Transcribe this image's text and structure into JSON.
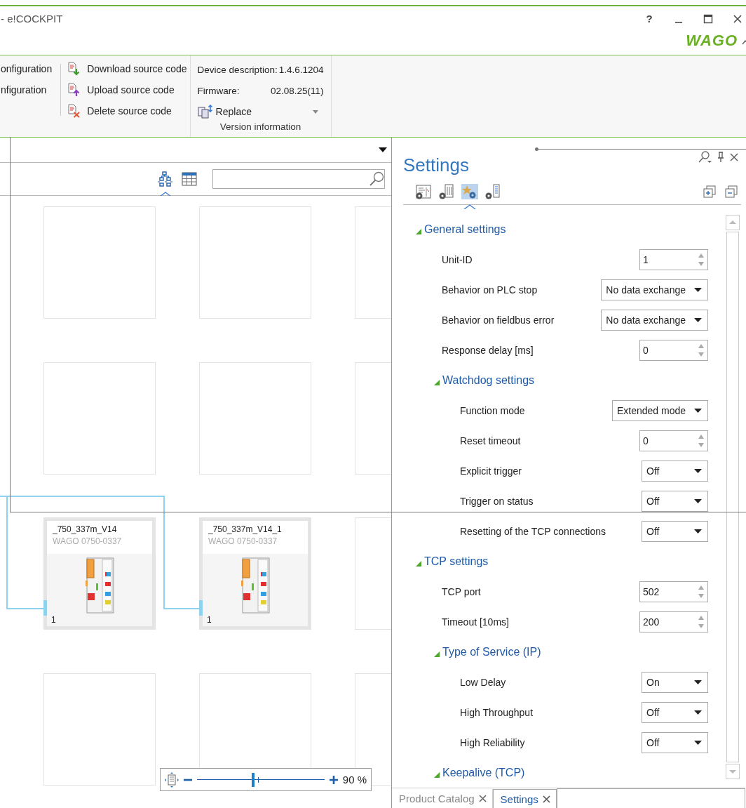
{
  "window": {
    "title": "- e!COCKPIT",
    "help": "?",
    "logo": "WAGO"
  },
  "ribbon": {
    "cut_items": [
      {
        "label": "onfiguration"
      },
      {
        "label": "nfiguration"
      }
    ],
    "source_items": [
      {
        "kind": "download",
        "label": "Download source code"
      },
      {
        "kind": "upload",
        "label": "Upload source code"
      },
      {
        "kind": "delete",
        "label": "Delete source code"
      }
    ],
    "version": {
      "fields": [
        {
          "label": "Device description:",
          "value": "1.4.6.1204"
        },
        {
          "label": "Firmware:",
          "value": "02.08.25(11)"
        }
      ],
      "replace": "Replace",
      "caption": "Version information"
    }
  },
  "network_view": {
    "views": [
      {
        "kind": "tree",
        "selected": true
      },
      {
        "kind": "table",
        "selected": false
      }
    ],
    "devices": [
      {
        "name": "_750_337m_V14",
        "model": "WAGO 0750-0337",
        "slot": "1"
      },
      {
        "name": "_750_337m_V14_1",
        "model": "WAGO 0750-0337",
        "slot": "1"
      }
    ],
    "zoom": {
      "level": 0.44,
      "reading": "90 %"
    }
  },
  "settings": {
    "title": "Settings",
    "tabs": [
      {
        "selected": false
      },
      {
        "selected": false
      },
      {
        "selected": true
      },
      {
        "selected": false
      }
    ],
    "sections": [
      {
        "title": "General settings",
        "expanded": true,
        "rows": [
          {
            "kind": "spin",
            "label": "Unit-ID",
            "value": "1"
          },
          {
            "kind": "select",
            "label": "Behavior on PLC stop",
            "value": "No data exchange"
          },
          {
            "kind": "select",
            "label": "Behavior on fieldbus error",
            "value": "No data exchange"
          },
          {
            "kind": "spin",
            "label": "Response delay [ms]",
            "value": "0"
          }
        ],
        "children": [
          {
            "title": "Watchdog settings",
            "expanded": true,
            "rows": [
              {
                "kind": "select",
                "label": "Function mode",
                "value": "Extended mode"
              },
              {
                "kind": "spin",
                "label": "Reset timeout",
                "value": "0"
              },
              {
                "kind": "select",
                "label": "Explicit trigger",
                "value": "Off"
              },
              {
                "kind": "select",
                "label": "Trigger on status",
                "value": "Off"
              },
              {
                "kind": "select",
                "label": "Resetting of the TCP connections",
                "value": "Off"
              }
            ]
          }
        ]
      },
      {
        "title": "TCP settings",
        "expanded": true,
        "rows": [
          {
            "kind": "spin",
            "label": "TCP port",
            "value": "502"
          },
          {
            "kind": "spin",
            "label": "Timeout [10ms]",
            "value": "200"
          }
        ],
        "children": [
          {
            "title": "Type of Service (IP)",
            "expanded": true,
            "rows": [
              {
                "kind": "select",
                "label": "Low Delay",
                "value": "On"
              },
              {
                "kind": "select",
                "label": "High Throughput",
                "value": "Off"
              },
              {
                "kind": "select",
                "label": "High Reliability",
                "value": "Off"
              }
            ]
          },
          {
            "title": "Keepalive (TCP)",
            "expanded": true
          }
        ]
      }
    ]
  },
  "bottom_tabs": [
    {
      "label": "Product Catalog",
      "selected": false
    },
    {
      "label": "Settings",
      "selected": true
    }
  ]
}
